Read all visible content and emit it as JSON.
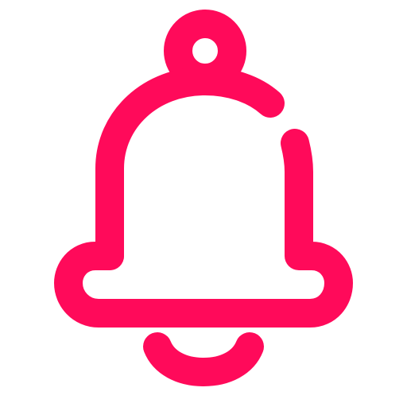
{
  "icon": {
    "name": "bell-icon",
    "stroke_color": "#ff0a5a",
    "background_color": "#ffffff"
  }
}
